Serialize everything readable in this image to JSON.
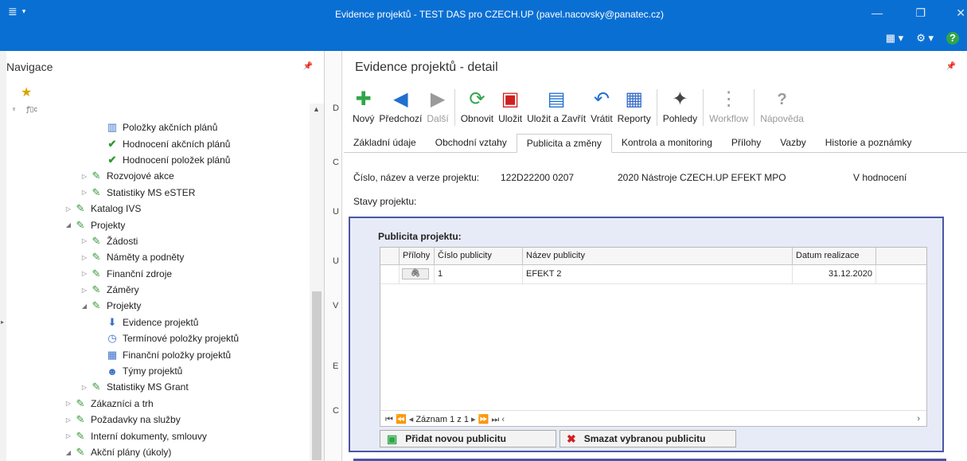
{
  "window": {
    "title": "Evidence projektů - TEST DAS pro CZECH.UP (pavel.nacovsky@panatec.cz)"
  },
  "nav": {
    "title": "Navigace",
    "tree_header": "ꝭ▯c",
    "items": [
      {
        "label": "Položky akčních plánů",
        "icon": "chart-doc-icon"
      },
      {
        "label": "Hodnocení akčních plánů",
        "icon": "check-icon"
      },
      {
        "label": "Hodnocení položek plánů",
        "icon": "check-icon"
      },
      {
        "label": "Rozvojové akce",
        "icon": "pin-icon"
      },
      {
        "label": "Statistiky MS eSTER",
        "icon": "pin-icon"
      },
      {
        "label": "Katalog IVS",
        "icon": "pin-icon"
      },
      {
        "label": "Projekty",
        "icon": "pin-icon"
      },
      {
        "label": "Žádosti",
        "icon": "pin-icon"
      },
      {
        "label": "Náměty a podněty",
        "icon": "pin-icon"
      },
      {
        "label": "Finanční zdroje",
        "icon": "pin-icon"
      },
      {
        "label": "Záměry",
        "icon": "pin-icon"
      },
      {
        "label": "Projekty",
        "icon": "pin-icon"
      },
      {
        "label": "Evidence projektů",
        "icon": "stack-icon"
      },
      {
        "label": "Termínové položky projektů",
        "icon": "clock-icon"
      },
      {
        "label": "Finanční položky projektů",
        "icon": "calc-icon"
      },
      {
        "label": "Týmy projektů",
        "icon": "team-icon"
      },
      {
        "label": "Statistiky MS Grant",
        "icon": "pin-icon"
      },
      {
        "label": "Zákazníci a trh",
        "icon": "pin-icon"
      },
      {
        "label": "Požadavky na služby",
        "icon": "pin-icon"
      },
      {
        "label": "Interní dokumenty, smlouvy",
        "icon": "pin-icon"
      },
      {
        "label": "Akční plány (úkoly)",
        "icon": "pin-icon"
      }
    ]
  },
  "mid_strip": [
    "D",
    "C",
    "U",
    "U",
    "V",
    "E",
    "C"
  ],
  "main": {
    "title": "Evidence projektů - detail",
    "toolbar": [
      {
        "label": "Nový",
        "icon": "plus-icon",
        "color": "#2fa64a",
        "disabled": false
      },
      {
        "label": "Předchozí",
        "icon": "prev-icon",
        "color": "#1f6fd0",
        "disabled": false
      },
      {
        "label": "Další",
        "icon": "next-icon",
        "color": "#9a9a9a",
        "disabled": true
      },
      {
        "label": "Obnovit",
        "icon": "refresh-icon",
        "color": "#2fa64a",
        "disabled": false
      },
      {
        "label": "Uložit",
        "icon": "save-icon",
        "color": "#d02020",
        "disabled": false
      },
      {
        "label": "Uložit a Zavřít",
        "icon": "save-close-icon",
        "color": "#1f6fd0",
        "disabled": false
      },
      {
        "label": "Vrátit",
        "icon": "undo-icon",
        "color": "#1f6fd0",
        "disabled": false
      },
      {
        "label": "Reporty",
        "icon": "report-icon",
        "color": "#3a6fc9",
        "disabled": false
      },
      {
        "label": "Pohledy",
        "icon": "wand-icon",
        "color": "#444",
        "disabled": false
      },
      {
        "label": "Workflow",
        "icon": "workflow-icon",
        "color": "#9a9a9a",
        "disabled": true
      },
      {
        "label": "Nápověda",
        "icon": "help-icon",
        "color": "#9a9a9a",
        "disabled": true
      }
    ],
    "tabs": [
      {
        "label": "Základní údaje",
        "active": false
      },
      {
        "label": "Obchodní vztahy",
        "active": false
      },
      {
        "label": "Publicita a změny",
        "active": true
      },
      {
        "label": "Kontrola a monitoring",
        "active": false
      },
      {
        "label": "Přílohy",
        "active": false
      },
      {
        "label": "Vazby",
        "active": false
      },
      {
        "label": "Historie a poznámky",
        "active": false
      }
    ],
    "project": {
      "label": "Číslo, název a verze projektu:",
      "number": "122D22200 0207",
      "name": "2020 Nástroje CZECH.UP EFEKT MPO",
      "status": "V hodnocení"
    },
    "stavy_label": "Stavy projektu:",
    "publicity": {
      "title": "Publicita projektu:",
      "columns": [
        "Přílohy",
        "Číslo publicity",
        "Název publicity",
        "Datum realizace"
      ],
      "rows": [
        {
          "cislo": "1",
          "nazev": "EFEKT 2",
          "datum": "31.12.2020"
        }
      ],
      "nav_text": "Záznam 1 z 1",
      "add_label": "Přidat novou publicitu",
      "delete_label": "Smazat vybranou publicitu"
    }
  },
  "colors": {
    "titlebar": "#0a6fd3",
    "panel_border": "#4b56a4",
    "panel_bg": "#e7ebf7"
  }
}
